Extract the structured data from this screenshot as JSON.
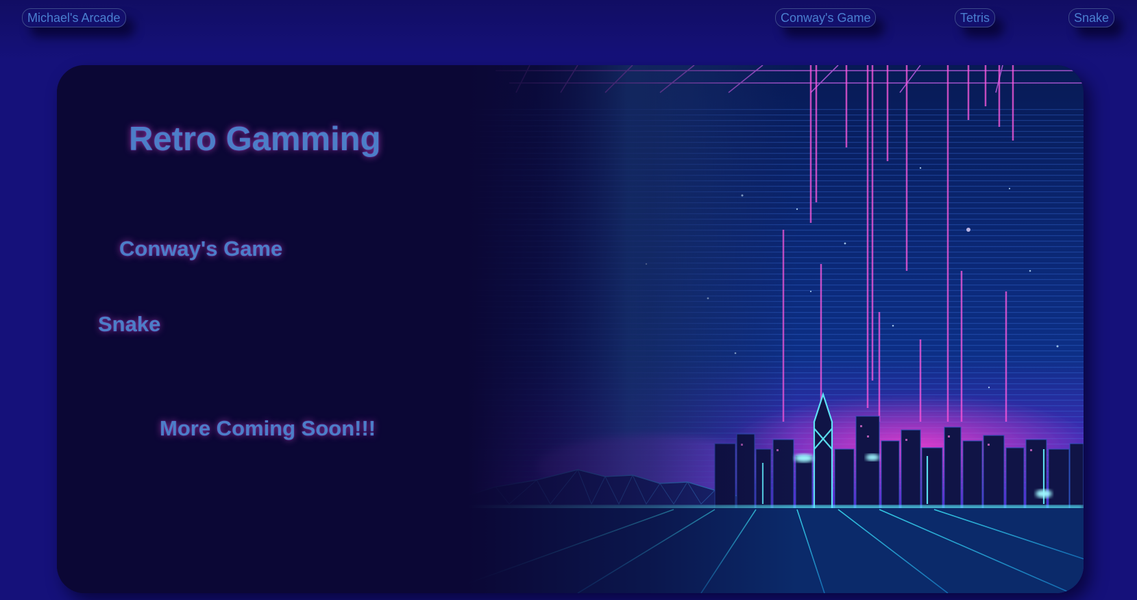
{
  "nav": {
    "brand": "Michael's Arcade",
    "links": [
      "Conway's Game",
      "Tetris",
      "Snake"
    ]
  },
  "hero": {
    "title": "Retro Gamming",
    "games": [
      "Conway's Game",
      "Snake"
    ],
    "coming_soon": "More Coming Soon!!!"
  },
  "colors": {
    "page_bg": "#15117a",
    "card_bg": "#0b0735",
    "text": "#4c7ec8",
    "neon_pink": "#ff4fd8",
    "neon_cyan": "#3fe6ff"
  }
}
